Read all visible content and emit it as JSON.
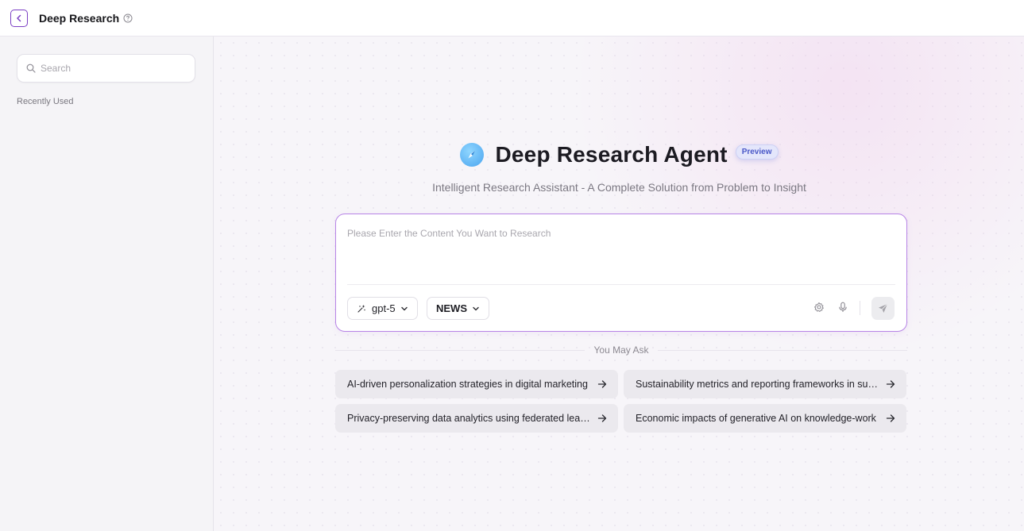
{
  "header": {
    "title": "Deep Research",
    "back_icon": "chevron-left-icon",
    "help_icon": "question-circle-icon",
    "accent_color": "#7b3fc4"
  },
  "sidebar": {
    "search_placeholder": "Search",
    "recently_used_label": "Recently Used"
  },
  "main": {
    "title": "Deep Research Agent",
    "badge": "Preview",
    "subtitle": "Intelligent Research Assistant - A Complete Solution from Problem to Insight",
    "input_placeholder": "Please Enter the Content You Want to Research",
    "input_value": "",
    "model_selected": "gpt-5",
    "source_selected": "NEWS",
    "you_may_ask_label": "You May Ask",
    "suggestions": [
      "AI-driven personalization strategies in digital marketing",
      "Sustainability metrics and reporting frameworks in supply chains",
      "Privacy-preserving data analytics using federated learning",
      "Economic impacts of generative AI on knowledge-work"
    ]
  },
  "colors": {
    "input_border": "#b784e6",
    "badge_text": "#4a58c8",
    "logo": "#4aa4ef"
  }
}
